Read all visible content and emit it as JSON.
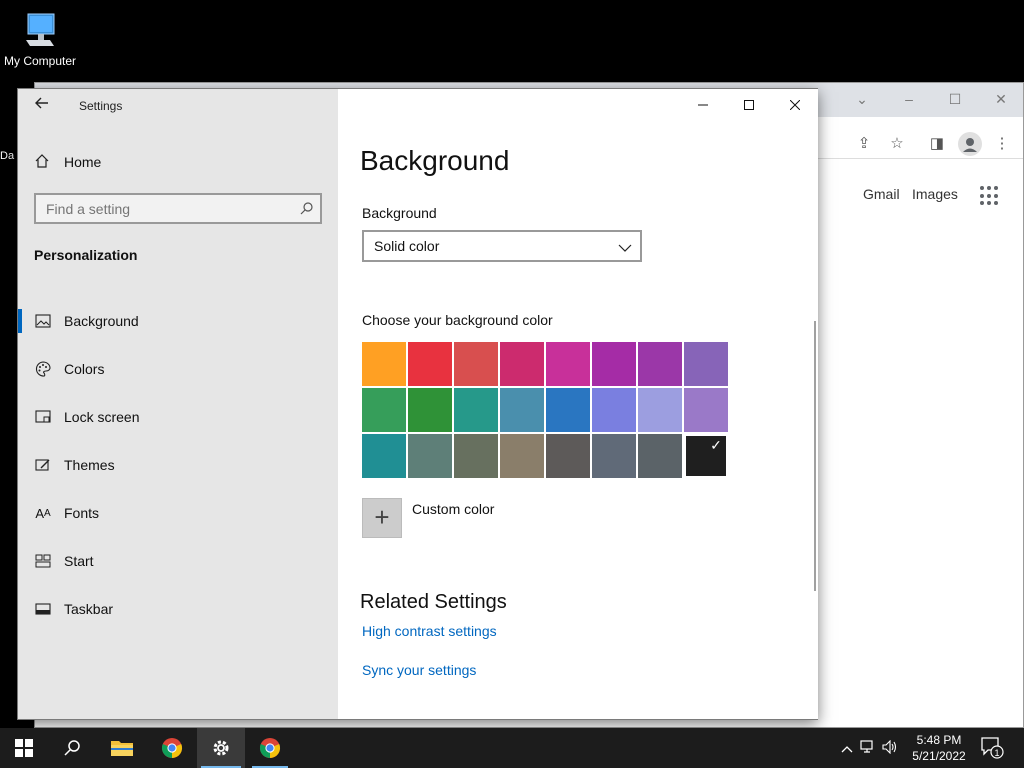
{
  "desktop": {
    "icon_label": "My Computer",
    "partial_label": "Da"
  },
  "browser": {
    "links": {
      "gmail": "Gmail",
      "images": "Images"
    }
  },
  "settings": {
    "window_title": "Settings",
    "home_label": "Home",
    "search_placeholder": "Find a setting",
    "section_title": "Personalization",
    "nav_items": [
      {
        "label": "Background",
        "icon": "picture-icon",
        "selected": true
      },
      {
        "label": "Colors",
        "icon": "palette-icon",
        "selected": false
      },
      {
        "label": "Lock screen",
        "icon": "lock-screen-icon",
        "selected": false
      },
      {
        "label": "Themes",
        "icon": "themes-icon",
        "selected": false
      },
      {
        "label": "Fonts",
        "icon": "fonts-icon",
        "selected": false
      },
      {
        "label": "Start",
        "icon": "start-icon",
        "selected": false
      },
      {
        "label": "Taskbar",
        "icon": "taskbar-icon",
        "selected": false
      }
    ],
    "page_title": "Background",
    "background_label": "Background",
    "background_value": "Solid color",
    "choose_color_label": "Choose your background color",
    "palette_colors": [
      "#ffa023",
      "#e8323f",
      "#d84f4f",
      "#cc2b6e",
      "#c8309a",
      "#a52ca6",
      "#9b37a8",
      "#8764b8",
      "#369e5a",
      "#2f9237",
      "#26998a",
      "#4a8fad",
      "#2a76c1",
      "#7a7fe0",
      "#9c9ee0",
      "#9a79c8",
      "#208f94",
      "#5e7f78",
      "#67705f",
      "#8a7e6a",
      "#5d5a59",
      "#606a78",
      "#5b6368",
      "#1f1f1f"
    ],
    "selected_color_index": 23,
    "custom_color_label": "Custom color",
    "related_title": "Related Settings",
    "related_links": [
      "High contrast settings",
      "Sync your settings"
    ]
  },
  "taskbar": {
    "time": "5:48 PM",
    "date": "5/21/2022",
    "notification_count": "1"
  }
}
